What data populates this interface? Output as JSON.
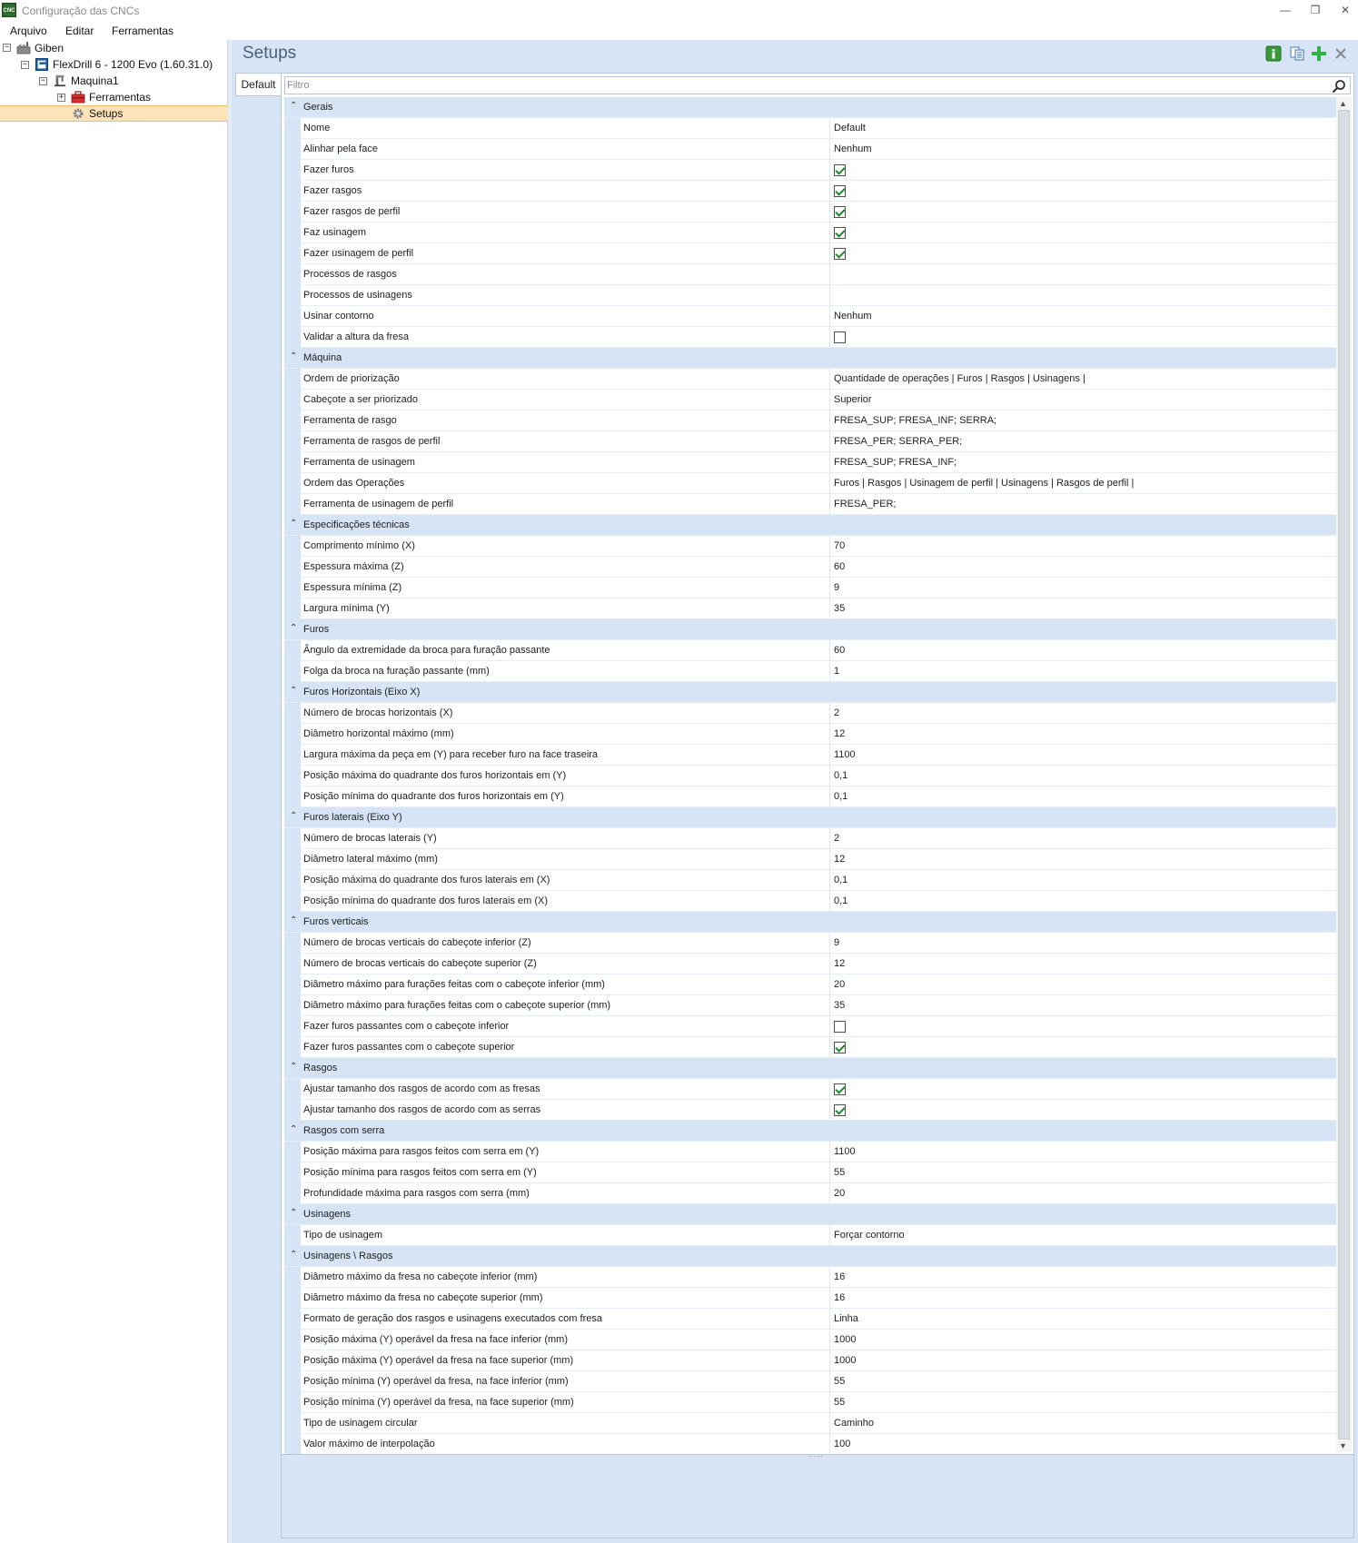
{
  "window": {
    "title": "Configuração das CNCs",
    "app_icon_text": "CNC",
    "minimize": "—",
    "restore": "❐",
    "close": "✕"
  },
  "menu": [
    "Arquivo",
    "Editar",
    "Ferramentas"
  ],
  "tree": {
    "root": "Giben",
    "machine_model": "FlexDrill 6 - 1200 Evo (1.60.31.0)",
    "machine": "Maquina1",
    "tools": "Ferramentas",
    "setups": "Setups",
    "collapse_glyph": "−",
    "expand_glyph": "+"
  },
  "panel": {
    "title": "Setups",
    "tab": "Default"
  },
  "filter": {
    "placeholder": "Filtro",
    "value": ""
  },
  "categories": [
    {
      "name": "Gerais",
      "props": [
        {
          "name": "Nome",
          "value": "Default"
        },
        {
          "name": "Alinhar pela face",
          "value": "Nenhum"
        },
        {
          "name": "Fazer furos",
          "checked": true
        },
        {
          "name": "Fazer rasgos",
          "checked": true
        },
        {
          "name": "Fazer rasgos de perfil",
          "checked": true
        },
        {
          "name": "Faz usinagem",
          "checked": true
        },
        {
          "name": "Fazer usinagem de perfil",
          "checked": true
        },
        {
          "name": "Processos de rasgos",
          "value": ""
        },
        {
          "name": "Processos de usinagens",
          "value": ""
        },
        {
          "name": "Usinar contorno",
          "value": "Nenhum"
        },
        {
          "name": "Validar a altura da fresa",
          "checked": false
        }
      ]
    },
    {
      "name": "Máquina",
      "props": [
        {
          "name": "Ordem de priorização",
          "value": "Quantidade de operações | Furos | Rasgos | Usinagens |"
        },
        {
          "name": "Cabeçote a ser priorizado",
          "value": "Superior"
        },
        {
          "name": "Ferramenta de rasgo",
          "value": "FRESA_SUP; FRESA_INF; SERRA;"
        },
        {
          "name": "Ferramenta de rasgos de perfil",
          "value": "FRESA_PER; SERRA_PER;"
        },
        {
          "name": "Ferramenta de usinagem",
          "value": "FRESA_SUP; FRESA_INF;"
        },
        {
          "name": "Ordem das Operações",
          "value": "Furos | Rasgos | Usinagem de perfil | Usinagens | Rasgos de perfil |"
        },
        {
          "name": "Ferramenta de usinagem de perfil",
          "value": "FRESA_PER;"
        }
      ]
    },
    {
      "name": "Especificações técnicas",
      "props": [
        {
          "name": "Comprimento mínimo (X)",
          "value": "70"
        },
        {
          "name": "Espessura máxima (Z)",
          "value": "60"
        },
        {
          "name": "Espessura mínima (Z)",
          "value": "9"
        },
        {
          "name": "Largura mínima (Y)",
          "value": "35"
        }
      ]
    },
    {
      "name": "Furos",
      "props": [
        {
          "name": "Ângulo da extremidade da broca para furação passante",
          "value": "60"
        },
        {
          "name": "Folga da broca na furação passante (mm)",
          "value": "1"
        }
      ]
    },
    {
      "name": "Furos Horizontais (Eixo X)",
      "props": [
        {
          "name": "Número de brocas horizontais (X)",
          "value": "2"
        },
        {
          "name": "Diâmetro horizontal máximo (mm)",
          "value": "12"
        },
        {
          "name": "Largura máxima da peça em (Y) para receber furo na face traseira",
          "value": "1100"
        },
        {
          "name": "Posição máxima do quadrante dos furos horizontais em (Y)",
          "value": "0,1"
        },
        {
          "name": "Posição mínima do quadrante dos furos horizontais em (Y)",
          "value": "0,1"
        }
      ]
    },
    {
      "name": "Furos laterais (Eixo Y)",
      "props": [
        {
          "name": "Número de brocas laterais (Y)",
          "value": "2"
        },
        {
          "name": "Diâmetro lateral máximo (mm)",
          "value": "12"
        },
        {
          "name": "Posição máxima do quadrante dos furos laterais em (X)",
          "value": "0,1"
        },
        {
          "name": "Posição mínima do quadrante dos furos laterais em (X)",
          "value": "0,1"
        }
      ]
    },
    {
      "name": "Furos verticais",
      "props": [
        {
          "name": "Número de brocas verticais do cabeçote inferior (Z)",
          "value": "9"
        },
        {
          "name": "Número de brocas verticais do cabeçote superior (Z)",
          "value": "12"
        },
        {
          "name": "Diâmetro máximo para furações feitas com o cabeçote inferior (mm)",
          "value": "20"
        },
        {
          "name": "Diâmetro máximo para furações feitas com o cabeçote superior (mm)",
          "value": "35"
        },
        {
          "name": "Fazer furos passantes com o cabeçote inferior",
          "checked": false
        },
        {
          "name": "Fazer furos passantes com o cabeçote superior",
          "checked": true
        }
      ]
    },
    {
      "name": "Rasgos",
      "props": [
        {
          "name": "Ajustar tamanho dos rasgos de acordo com as fresas",
          "checked": true
        },
        {
          "name": "Ajustar tamanho dos rasgos de acordo com as serras",
          "checked": true
        }
      ]
    },
    {
      "name": "Rasgos com serra",
      "props": [
        {
          "name": "Posição máxima para rasgos feitos com serra em (Y)",
          "value": "1100"
        },
        {
          "name": "Posição mínima para rasgos feitos com serra em (Y)",
          "value": "55"
        },
        {
          "name": "Profundidade máxima para rasgos com serra (mm)",
          "value": "20"
        }
      ]
    },
    {
      "name": "Usinagens",
      "props": [
        {
          "name": "Tipo de usinagem",
          "value": "Forçar contorno"
        }
      ]
    },
    {
      "name": "Usinagens \\ Rasgos",
      "props": [
        {
          "name": "Diâmetro máximo da fresa no cabeçote inferior (mm)",
          "value": "16"
        },
        {
          "name": "Diâmetro máximo da fresa no cabeçote superior (mm)",
          "value": "16"
        },
        {
          "name": "Formato de geração dos rasgos e usinagens executados com fresa",
          "value": "Linha"
        },
        {
          "name": "Posição máxima (Y) operável da fresa na face inferior (mm)",
          "value": "1000"
        },
        {
          "name": "Posição máxima (Y) operável da fresa na face superior (mm)",
          "value": "1000"
        },
        {
          "name": "Posição mínima (Y) operável da fresa, na face inferior (mm)",
          "value": "55"
        },
        {
          "name": "Posição mínima (Y) operável da fresa, na face superior (mm)",
          "value": "55"
        },
        {
          "name": "Tipo de usinagem circular",
          "value": "Caminho"
        },
        {
          "name": "Valor máximo de interpolação",
          "value": "100"
        }
      ]
    }
  ],
  "icons": {
    "category_collapse": "chevron-up-icon",
    "search": "search-icon",
    "toolbar": [
      "info-icon",
      "copy-icon",
      "add-icon",
      "close-icon"
    ]
  },
  "colors": {
    "accent_blue": "#d6e4f5",
    "selection": "#fde3b8",
    "check": "#1f8a2b",
    "add_green": "#2fb344",
    "info_green": "#3a9a3a"
  }
}
